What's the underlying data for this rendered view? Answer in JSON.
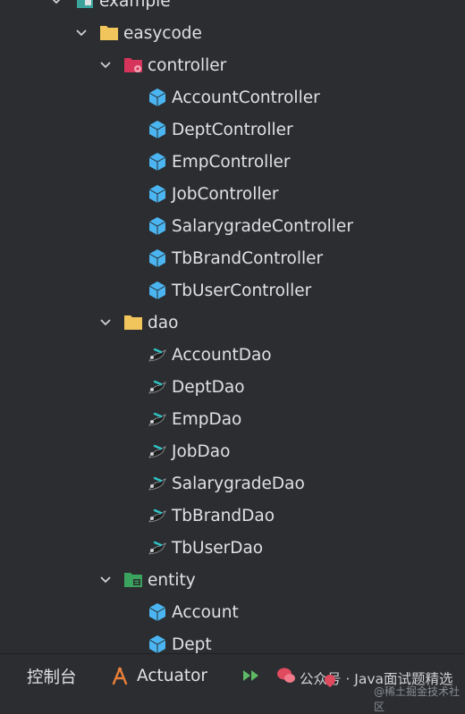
{
  "tree": {
    "example": "example",
    "easycode": "easycode",
    "controller": {
      "label": "controller",
      "items": [
        "AccountController",
        "DeptController",
        "EmpController",
        "JobController",
        "SalarygradeController",
        "TbBrandController",
        "TbUserController"
      ]
    },
    "dao": {
      "label": "dao",
      "items": [
        "AccountDao",
        "DeptDao",
        "EmpDao",
        "JobDao",
        "SalarygradeDao",
        "TbBrandDao",
        "TbUserDao"
      ]
    },
    "entity": {
      "label": "entity",
      "items": [
        "Account",
        "Dept"
      ]
    }
  },
  "bottom_bar": {
    "console_label": "控制台",
    "actuator_label": "Actuator",
    "watermark": "公众号 · Java面试题精选",
    "watermark_sub": "@稀土掘金技术社区"
  },
  "colors": {
    "background": "#2b2d30",
    "text": "#dfe1e5",
    "class_icon": "#4ab5f1",
    "folder": "#f2c55c",
    "controller_folder": "#d6345b",
    "entity_folder": "#3aa35d"
  }
}
